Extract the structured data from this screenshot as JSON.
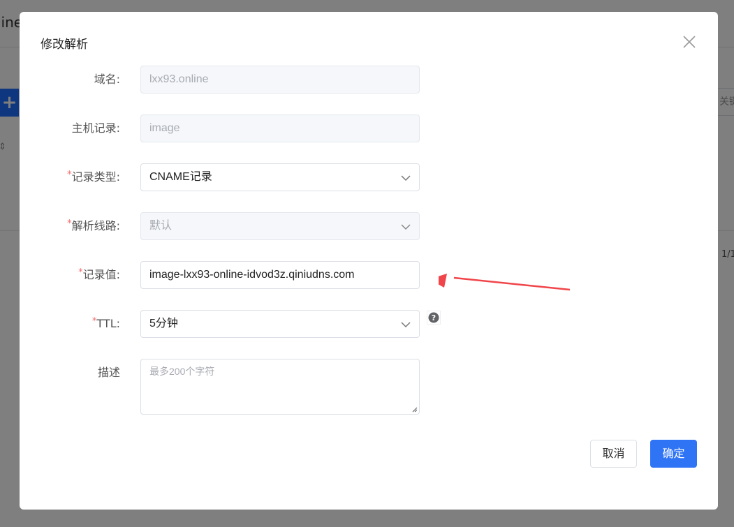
{
  "background": {
    "partial_title": "line",
    "partial_search": "关键",
    "partial_pager": "1/1"
  },
  "dialog": {
    "title": "修改解析",
    "fields": {
      "domain": {
        "label": "域名:",
        "value": "lxx93.online",
        "required": false
      },
      "host": {
        "label": "主机记录:",
        "value": "image",
        "required": false
      },
      "record_type": {
        "label": "记录类型:",
        "value": "CNAME记录",
        "required": true
      },
      "line": {
        "label": "解析线路:",
        "value": "默认",
        "required": true
      },
      "record_value": {
        "label": "记录值:",
        "value": "image-lxx93-online-idvod3z.qiniudns.com",
        "required": true
      },
      "ttl": {
        "label": "TTL:",
        "value": "5分钟",
        "required": true
      },
      "description": {
        "label": "描述",
        "placeholder": "最多200个字符",
        "value": ""
      }
    },
    "required_mark": "*",
    "buttons": {
      "cancel": "取消",
      "confirm": "确定"
    }
  },
  "icons": {
    "close": "close-icon",
    "chevron": "chevron-down-icon",
    "help": "help-icon"
  },
  "colors": {
    "primary": "#2f74f5",
    "required": "#f56c6c",
    "annotation_arrow": "#f0454a"
  }
}
